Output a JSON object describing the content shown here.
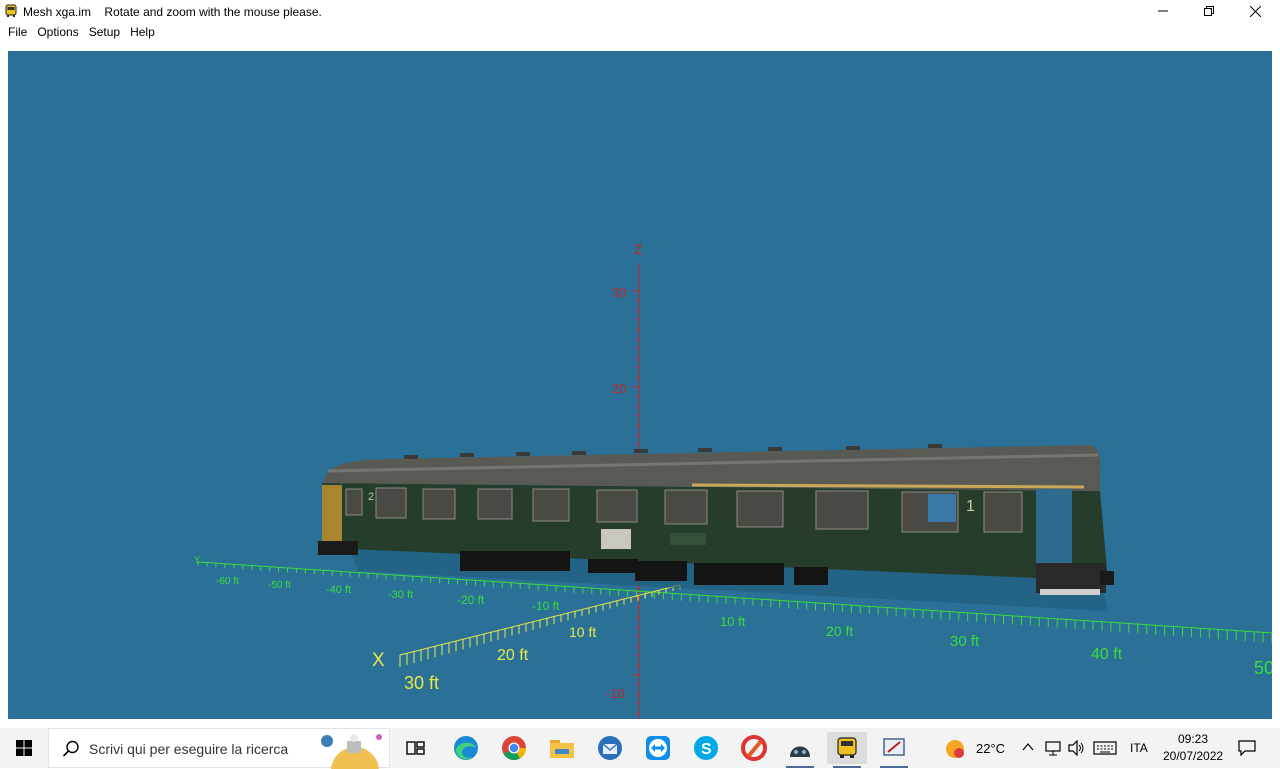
{
  "window": {
    "app_name": "Mesh xga.im",
    "message": "Rotate and zoom with the mouse please."
  },
  "menu": [
    "File",
    "Options",
    "Setup",
    "Help"
  ],
  "viewport": {
    "background": "#2a7097",
    "z_axis_label": "Z",
    "z_ticks": [
      "30",
      "20",
      "-10"
    ],
    "x_axis_label": "X",
    "x_ticks": [
      "10 ft",
      "20 ft",
      "30 ft"
    ],
    "y_axis_label": "Y",
    "y_ticks": [
      "-60 ft",
      "-50 ft",
      "-40 ft",
      "-30 ft",
      "-20 ft",
      "-10 ft",
      "10 ft",
      "20 ft",
      "30 ft",
      "40 ft",
      "50"
    ],
    "coach_class_numbers": [
      "2",
      "1"
    ]
  },
  "taskbar": {
    "search_placeholder": "Scrivi qui per eseguire la ricerca",
    "weather_temp": "22°C",
    "language": "ITA",
    "time": "09:23",
    "date": "20/07/2022"
  }
}
